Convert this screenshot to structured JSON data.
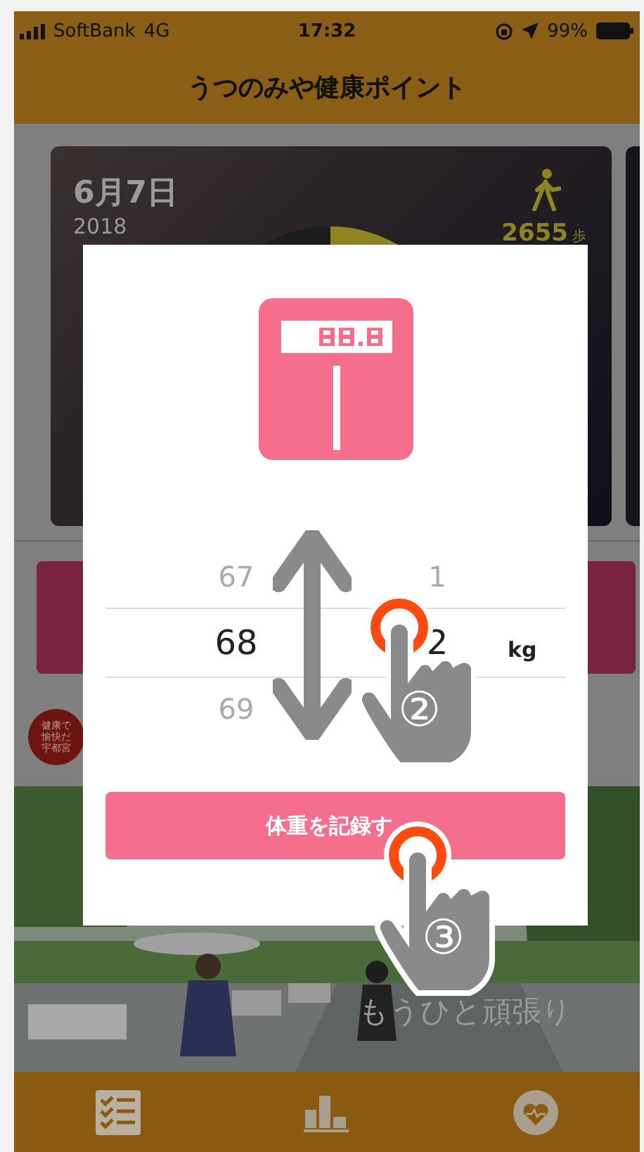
{
  "status_bar": {
    "carrier": "SoftBank",
    "network": "4G",
    "time": "17:32",
    "battery": "99%"
  },
  "header": {
    "title": "うつのみや健康ポイント"
  },
  "summary_card": {
    "date": "6月7日",
    "year": "2018",
    "steps": "2655",
    "steps_unit": "歩"
  },
  "badge": {
    "lines": [
      "健康で",
      "愉快だ",
      "宇都宮"
    ]
  },
  "banner": {
    "kind": "picture",
    "caption": "もうひと頑張り"
  },
  "tab_bar": {
    "items": [
      {
        "kind": "checklist"
      },
      {
        "kind": "chart"
      },
      {
        "kind": "heart"
      }
    ]
  },
  "dialog": {
    "picker": {
      "rows": [
        {
          "whole": "67",
          "decimal": "1",
          "selected": false
        },
        {
          "whole": "68",
          "decimal": "2",
          "selected": true
        },
        {
          "whole": "69",
          "selected": false
        }
      ],
      "unit": "kg"
    },
    "button": "体重を記録す"
  },
  "annotations": [
    {
      "kind": "arrow"
    },
    {
      "kind": "tap",
      "label": "②"
    },
    {
      "kind": "tap",
      "label": "③"
    }
  ]
}
